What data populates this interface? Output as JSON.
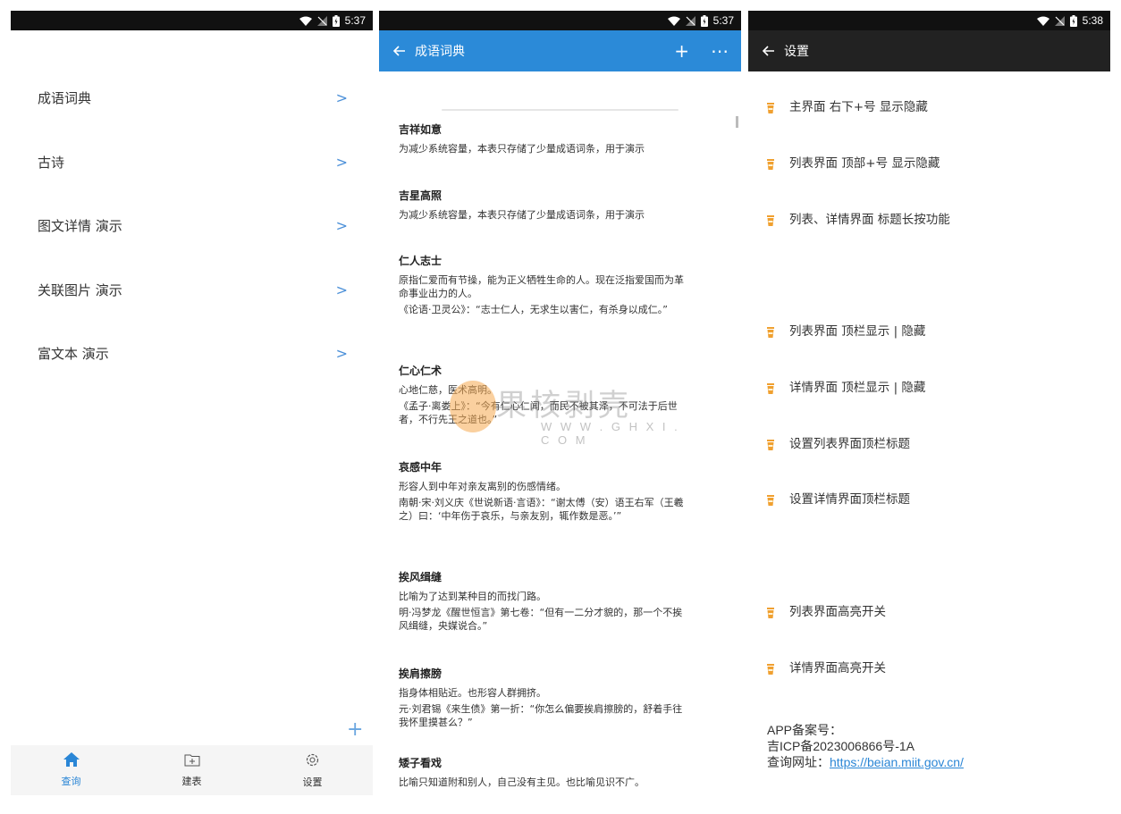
{
  "screens": {
    "home": {
      "status_time": "5:37",
      "menu_items": [
        {
          "label": "成语词典"
        },
        {
          "label": "古诗"
        },
        {
          "label": "图文详情 演示"
        },
        {
          "label": "关联图片 演示"
        },
        {
          "label": "富文本 演示"
        }
      ],
      "chevron": ">",
      "fab": "+",
      "nav": [
        {
          "label": "查询",
          "icon": "home-icon",
          "active": true
        },
        {
          "label": "建表",
          "icon": "add-table-icon",
          "active": false
        },
        {
          "label": "设置",
          "icon": "gear-icon",
          "active": false
        }
      ]
    },
    "idioms": {
      "status_time": "5:37",
      "title": "成语词典",
      "add_icon": "+",
      "more_icon": "⋯",
      "items": [
        {
          "name": "吉祥如意",
          "meaning": "为减少系统容量，本表只存储了少量成语词条，用于演示",
          "source": ""
        },
        {
          "name": "吉星高照",
          "meaning": "为减少系统容量，本表只存储了少量成语词条，用于演示",
          "source": ""
        },
        {
          "name": "仁人志士",
          "meaning": "原指仁爱而有节操，能为正义牺牲生命的人。现在泛指爱国而为革命事业出力的人。",
          "source": "《论语·卫灵公》：“志士仁人，无求生以害仁，有杀身以成仁。”"
        },
        {
          "name": "仁心仁术",
          "meaning": "心地仁慈，医术高明。",
          "source": "《孟子·离娄上》：“今有仁心仁闻，而民不被其泽，不可法于后世者，不行先王之道也。”"
        },
        {
          "name": "哀感中年",
          "meaning": "形容人到中年对亲友离别的伤感情绪。",
          "source": "南朝·宋·刘义庆《世说新语·言语》：“谢太傅（安）语王右军（王羲之）曰：‘中年伤于哀乐，与亲友别，辄作数是恶。’”"
        },
        {
          "name": "挨风缉缝",
          "meaning": "比喻为了达到某种目的而找门路。",
          "source": "明·冯梦龙《醒世恒言》第七卷：“但有一二分才貌的，那一个不挨风缉缝，央媒说合。”"
        },
        {
          "name": "挨肩擦膀",
          "meaning": "指身体相贴近。也形容人群拥挤。",
          "source": "元·刘君锡《来生债》第一折：“你怎么偏要挨肩擦膀的，舒着手往我怀里摸甚么？”"
        },
        {
          "name": "矮子看戏",
          "meaning": "比喻只知道附和别人，自己没有主见。也比喻见识不广。",
          "source": ""
        }
      ]
    },
    "settings": {
      "status_time": "5:38",
      "title": "设置",
      "items": [
        {
          "label": "主界面 右下+号 显示隐藏"
        },
        {
          "label": "列表界面 顶部+号 显示隐藏"
        },
        {
          "label": "列表、详情界面 标题长按功能"
        },
        {
          "label": "列表界面  顶栏显示 | 隐藏"
        },
        {
          "label": "详情界面  顶栏显示 | 隐藏"
        },
        {
          "label": "设置列表界面顶栏标题"
        },
        {
          "label": "设置详情界面顶栏标题"
        },
        {
          "label": "列表界面高亮开关"
        },
        {
          "label": "详情界面高亮开关"
        }
      ],
      "beian_line1": "APP备案号：",
      "beian_line2": "吉ICP备2023006866号-1A",
      "beian_query_label": "查询网址：",
      "beian_url": "https://beian.miit.gov.cn/"
    }
  },
  "watermark": {
    "text": "果核剥壳",
    "sub": "W W W . G H X I . C O M"
  },
  "colors": {
    "accent_blue": "#2b8ad8",
    "dark_bar": "#222222",
    "cup_orange": "#f0a030"
  }
}
